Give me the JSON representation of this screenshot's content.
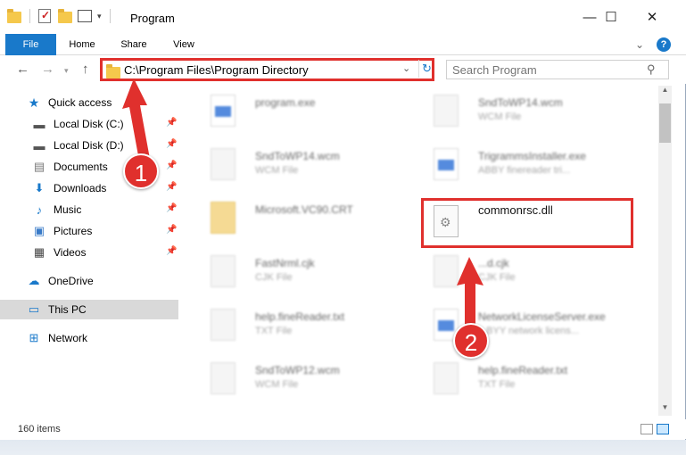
{
  "window": {
    "title": "Program"
  },
  "ribbon": {
    "file": "File",
    "home": "Home",
    "share": "Share",
    "view": "View"
  },
  "address": {
    "path": "C:\\Program Files\\Program Directory"
  },
  "search": {
    "placeholder": "Search Program"
  },
  "sidebar": {
    "quick_access": "Quick access",
    "items": [
      {
        "label": "Local Disk (C:)",
        "icon": "drive-icon",
        "pinned": true
      },
      {
        "label": "Local Disk (D:)",
        "icon": "drive-icon",
        "pinned": true
      },
      {
        "label": "Documents",
        "icon": "documents-icon",
        "pinned": true
      },
      {
        "label": "Downloads",
        "icon": "download-icon",
        "pinned": true
      },
      {
        "label": "Music",
        "icon": "music-icon",
        "pinned": true
      },
      {
        "label": "Pictures",
        "icon": "pictures-icon",
        "pinned": true
      },
      {
        "label": "Videos",
        "icon": "videos-icon",
        "pinned": true
      }
    ],
    "onedrive": "OneDrive",
    "this_pc": "This PC",
    "network": "Network"
  },
  "files": [
    {
      "name": "program.exe",
      "type": "",
      "icon": "exe",
      "blur": true
    },
    {
      "name": "SndToWP14.wcm",
      "type": "WCM File",
      "icon": "file",
      "blur": true
    },
    {
      "name": "SndToWP14.wcm",
      "type": "WCM File",
      "icon": "file",
      "blur": true
    },
    {
      "name": "TrigrammsInstaller.exe",
      "type": "ABBY finereader tri...",
      "icon": "exe",
      "blur": true
    },
    {
      "name": "Microsoft.VC90.CRT",
      "type": "",
      "icon": "folder",
      "blur": true
    },
    {
      "name": "commonrsc.dll",
      "type": "",
      "icon": "dll",
      "blur": false
    },
    {
      "name": "FastNrml.cjk",
      "type": "CJK File",
      "icon": "file",
      "blur": true
    },
    {
      "name": "...d.cjk",
      "type": "CJK File",
      "icon": "file",
      "blur": true
    },
    {
      "name": "help.fineReader.txt",
      "type": "TXT File",
      "icon": "file",
      "blur": true
    },
    {
      "name": "NetworkLicenseServer.exe",
      "type": "...BYY network licens...",
      "icon": "exe",
      "blur": true
    },
    {
      "name": "SndToWP12.wcm",
      "type": "WCM File",
      "icon": "file",
      "blur": true
    },
    {
      "name": "help.fineReader.txt",
      "type": "TXT File",
      "icon": "file",
      "blur": true
    }
  ],
  "status": {
    "count": "160 items"
  },
  "annotations": {
    "step1": "1",
    "step2": "2"
  },
  "colors": {
    "accent": "#1979ca",
    "annotation": "#e0302d"
  }
}
